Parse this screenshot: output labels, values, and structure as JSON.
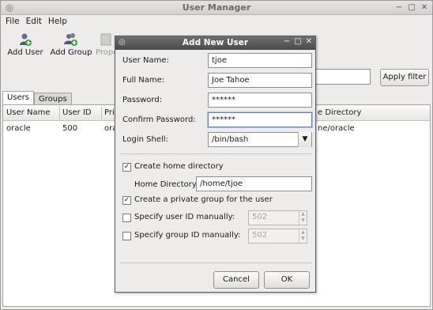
{
  "window": {
    "title": "User Manager"
  },
  "menu": {
    "file": "File",
    "edit": "Edit",
    "help": "Help"
  },
  "toolbar": {
    "add_user": "Add User",
    "add_group": "Add Group",
    "properties": "Prope"
  },
  "filter": {
    "apply_label": "Apply filter",
    "value": ""
  },
  "tabs": [
    {
      "label": "Users"
    },
    {
      "label": "Groups"
    }
  ],
  "columns": {
    "user_name": "User Name",
    "user_id": "User ID",
    "primary": "Prin",
    "home_dir": "e Directory"
  },
  "rows": [
    {
      "user_name": "oracle",
      "user_id": "500",
      "primary": "orac",
      "home_dir": "ne/oracle"
    }
  ],
  "dialog": {
    "title": "Add New User",
    "user_name_label": "User Name:",
    "user_name": "tjoe",
    "full_name_label": "Full Name:",
    "full_name": "Joe Tahoe",
    "password_label": "Password:",
    "password": "******",
    "confirm_label": "Confirm Password:",
    "confirm": "******",
    "shell_label": "Login Shell:",
    "shell": "/bin/bash",
    "create_home": "Create home directory",
    "home_dir_label": "Home Directory:",
    "home_dir": "/home/tjoe",
    "private_group": "Create a private group for the user",
    "specify_uid": "Specify user ID manually:",
    "uid_value": "502",
    "specify_gid": "Specify group ID manually:",
    "gid_value": "502",
    "cancel": "Cancel",
    "ok": "OK"
  }
}
